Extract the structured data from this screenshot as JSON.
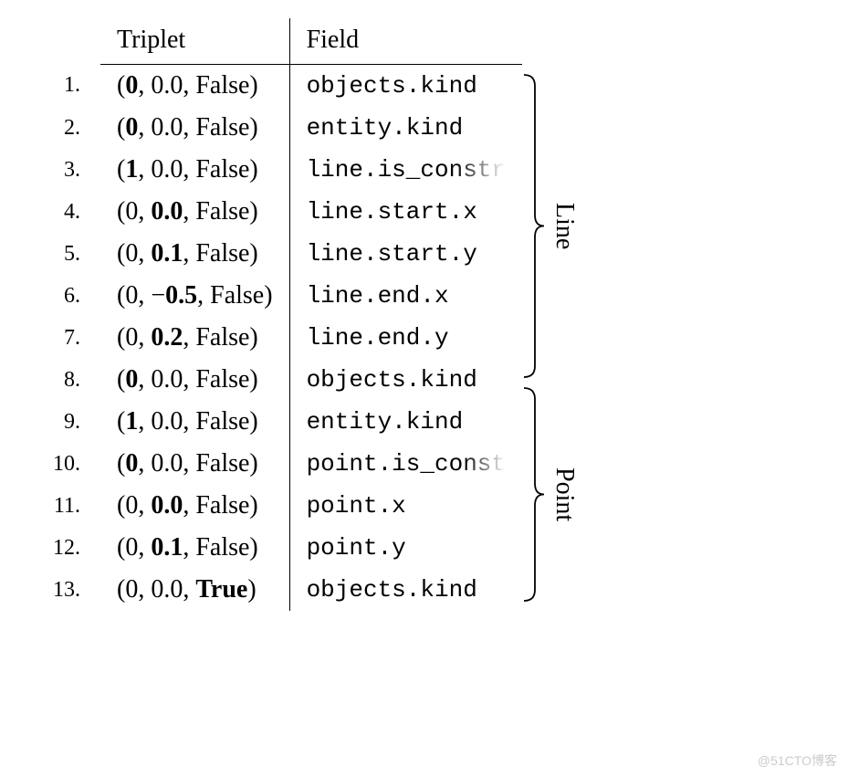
{
  "headers": {
    "triplet": "Triplet",
    "field": "Field"
  },
  "rows": [
    {
      "n": "1.",
      "triplet": "(<b>0</b>, 0.0, False)",
      "field": "objects.kind",
      "fade": ""
    },
    {
      "n": "2.",
      "triplet": "(<b>0</b>, 0.0, False)",
      "field": "entity.kind",
      "fade": ""
    },
    {
      "n": "3.",
      "triplet": "(<b>1</b>, 0.0, False)",
      "field": "line.is_",
      "fade": "constr"
    },
    {
      "n": "4.",
      "triplet": "(0, <b>0.0</b>, False)",
      "field": "line.start.x",
      "fade": ""
    },
    {
      "n": "5.",
      "triplet": "(0, <b>0.1</b>, False)",
      "field": "line.start.y",
      "fade": ""
    },
    {
      "n": "6.",
      "triplet": "(0, −<b>0.5</b>, False)",
      "field": "line.end.x",
      "fade": ""
    },
    {
      "n": "7.",
      "triplet": "(0, <b>0.2</b>, False)",
      "field": "line.end.y",
      "fade": ""
    },
    {
      "n": "8.",
      "triplet": "(<b>0</b>, 0.0, False)",
      "field": "objects.kind",
      "fade": ""
    },
    {
      "n": "9.",
      "triplet": "(<b>1</b>, 0.0, False)",
      "field": "entity.kind",
      "fade": ""
    },
    {
      "n": "10.",
      "triplet": "(<b>0</b>, 0.0, False)",
      "field": "point.is_",
      "fade": "const"
    },
    {
      "n": "11.",
      "triplet": "(0, <b>0.0</b>, False)",
      "field": "point.x",
      "fade": ""
    },
    {
      "n": "12.",
      "triplet": "(0, <b>0.1</b>, False)",
      "field": "point.y",
      "fade": ""
    },
    {
      "n": "13.",
      "triplet": "(0, 0.0, <b>True</b>)",
      "field": "objects.kind",
      "fade": ""
    }
  ],
  "braces": [
    {
      "label": "Line",
      "rows": 7
    },
    {
      "label": "Point",
      "rows": 5
    }
  ],
  "watermark": "@51CTO博客"
}
